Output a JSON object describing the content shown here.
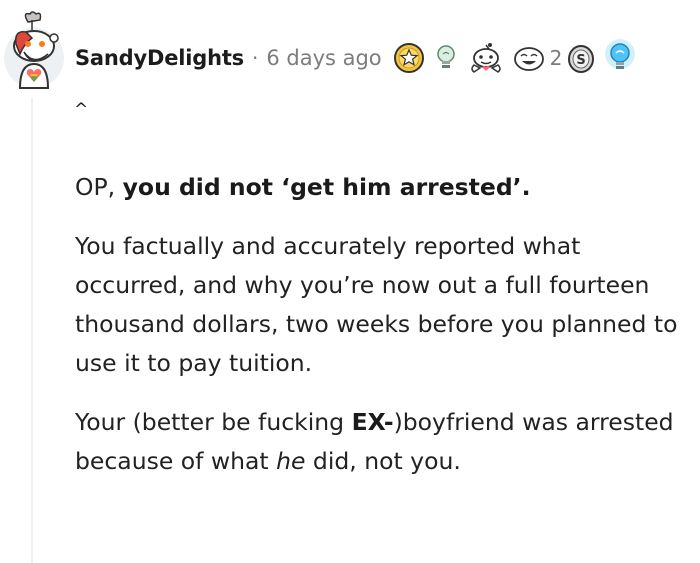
{
  "comment": {
    "username": "SandyDelights",
    "separator": "·",
    "timestamp": "6 days ago",
    "award_count": "2",
    "collapse_glyph": "^",
    "avatar_icon": "snoo-avatar-icon",
    "awards": [
      "gold-star-award-icon",
      "lightbulb-award-icon",
      "wholesome-snoo-award-icon",
      "smiley-award-icon",
      "silver-coin-award-icon",
      "glowing-lightbulb-award-icon"
    ],
    "paragraphs": {
      "p1": {
        "a": "OP, ",
        "b": "you did not ‘get him arrested’."
      },
      "p2": {
        "text": "You factually and accurately reported what occurred, and why you’re now out a full fourteen thousand dollars, two weeks before you planned to use it to pay tuition."
      },
      "p3": {
        "a": "Your (better be fucking ",
        "b": "EX-",
        "c": ")boyfriend was arrested because of what ",
        "d": "he",
        "e": " did, not you."
      }
    }
  },
  "colors": {
    "text": "#222222",
    "muted": "#7c7c7c",
    "thread_line": "#edeff1",
    "award_gold": "#f5c542",
    "award_blue": "#4fc3f7"
  }
}
